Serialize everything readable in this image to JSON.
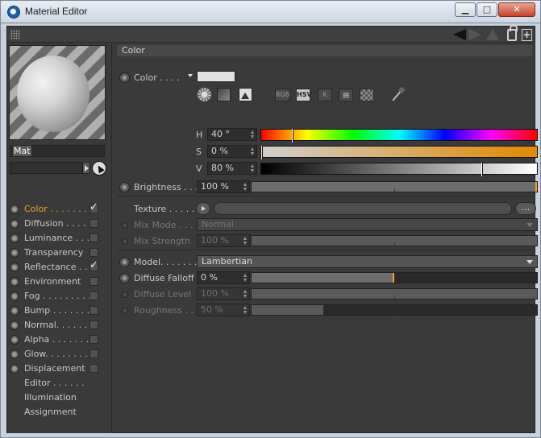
{
  "window": {
    "title": "Material Editor",
    "min_label": "▁",
    "max_label": "□",
    "close_label": "✕"
  },
  "material": {
    "name": "Mat"
  },
  "channels": [
    {
      "label": "Color . . . . . . .",
      "checked": true,
      "active": true
    },
    {
      "label": "Diffusion . . . .",
      "checked": false
    },
    {
      "label": "Luminance . . .",
      "checked": false
    },
    {
      "label": "Transparency",
      "checked": false
    },
    {
      "label": "Reflectance . .",
      "checked": true
    },
    {
      "label": "Environment",
      "checked": false
    },
    {
      "label": "Fog . . . . . . . . .",
      "checked": false
    },
    {
      "label": "Bump . . . . . . .",
      "checked": false
    },
    {
      "label": "Normal. . . . . . .",
      "checked": false
    },
    {
      "label": "Alpha . . . . . . .",
      "checked": false
    },
    {
      "label": "Glow. . . . . . . .",
      "checked": false
    },
    {
      "label": "Displacement",
      "checked": false
    }
  ],
  "extra_items": [
    "Editor . . . . . .",
    "Illumination",
    "Assignment"
  ],
  "section": {
    "title": "Color"
  },
  "color": {
    "label": "Color . . . .",
    "swatch": "#e2e2e2",
    "modes": [
      "RGB",
      "HSV",
      "K"
    ],
    "h_label": "H",
    "h_value": "40 °",
    "h_fraction": 0.11,
    "s_label": "S",
    "s_value": "0 %",
    "s_fraction": 0.0,
    "v_label": "V",
    "v_value": "80 %",
    "v_fraction": 0.8,
    "s_gradient_end": "#e08a00"
  },
  "brightness": {
    "label": "Brightness . . .",
    "value": "100 %",
    "fraction": 1.0
  },
  "texture": {
    "label": "Texture . . . . . .",
    "more_label": "..."
  },
  "mix_mode": {
    "label": "Mix Mode . . .",
    "value": "Normal"
  },
  "mix_strength": {
    "label": "Mix Strength",
    "value": "100 %",
    "fraction": 1.0
  },
  "model": {
    "label": "Model. . . . . . .",
    "value": "Lambertian"
  },
  "diffuse_falloff": {
    "label": "Diffuse Falloff",
    "value": "0 %",
    "fraction": 0.5
  },
  "diffuse_level": {
    "label": "Diffuse Level",
    "value": "100 %",
    "fraction": 1.0
  },
  "roughness": {
    "label": "Roughness . . .",
    "value": "50 %",
    "fraction": 0.25
  }
}
